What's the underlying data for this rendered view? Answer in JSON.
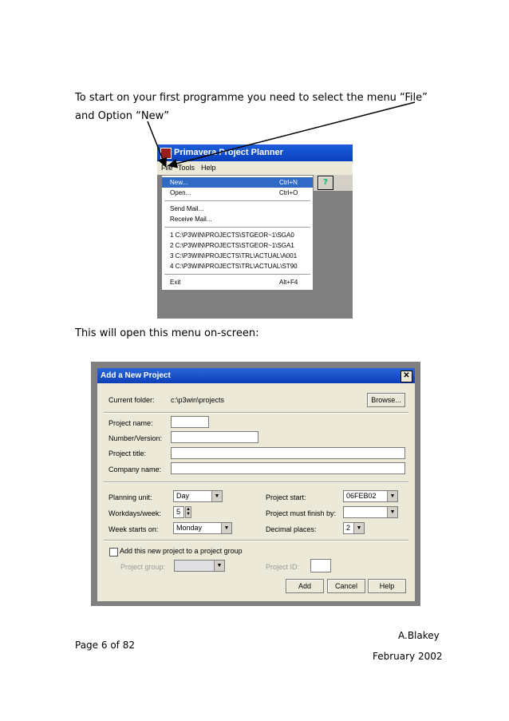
{
  "intro": {
    "line1": "To  start  on  your  first  programme  you  need  to  select  the  menu  “File”",
    "line2": "and Option “New”"
  },
  "menu_screenshot": {
    "app_title": "Primavera Project Planner",
    "menubar": [
      "File",
      "Tools",
      "Help"
    ],
    "items": [
      {
        "label": "New...",
        "shortcut": "Ctrl+N",
        "selected": true
      },
      {
        "label": "Open...",
        "shortcut": "Ctrl+O"
      },
      {
        "label": "Send Mail..."
      },
      {
        "label": "Receive Mail..."
      },
      {
        "label": "1 C:\\P3WIN\\PROJECTS\\STGEOR~1\\SGA0"
      },
      {
        "label": "2 C:\\P3WIN\\PROJECTS\\STGEOR~1\\SGA1"
      },
      {
        "label": "3 C:\\P3WIN\\PROJECTS\\TRL\\ACTUAL\\A001"
      },
      {
        "label": "4 C:\\P3WIN\\PROJECTS\\TRL\\ACTUAL\\ST90"
      },
      {
        "label": "Exit",
        "shortcut": "Alt+F4"
      }
    ],
    "help_icon": "question-mark-help-icon",
    "selection_color": "#316ac5",
    "titlebar_color": "#0a3fbd"
  },
  "middle_text": "This will open this menu on-screen:",
  "dialog": {
    "title": "Add a New Project",
    "current_folder_label": "Current folder:",
    "current_folder": "c:\\p3win\\projects",
    "browse": "Browse...",
    "project_name_label": "Project name:",
    "number_version_label": "Number/Version:",
    "project_title_label": "Project title:",
    "company_name_label": "Company name:",
    "planning_unit_label": "Planning unit:",
    "planning_unit": "Day",
    "workdays_label": "Workdays/week:",
    "workdays": "5",
    "week_starts_label": "Week starts on:",
    "week_starts": "Monday",
    "project_start_label": "Project start:",
    "project_start": "06FEB02",
    "must_finish_label": "Project must finish by:",
    "decimal_label": "Decimal places:",
    "decimal": "2",
    "add_group_label": "Add this new project to a project group",
    "project_group_label": "Project group:",
    "project_id_label": "Project ID:",
    "add": "Add",
    "cancel": "Cancel",
    "help": "Help"
  },
  "footer": {
    "author": "A.Blakey",
    "page": "Page 6 of 82",
    "date": "February 2002"
  }
}
